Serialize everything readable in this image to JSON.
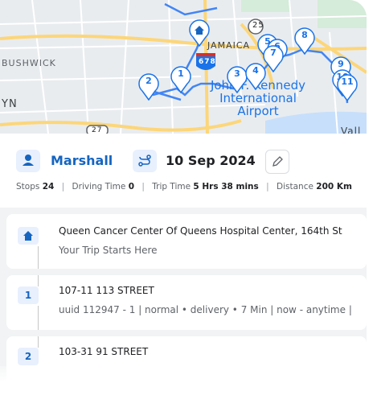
{
  "map": {
    "labels": {
      "bushwick": "BUSHWICK",
      "yn": "YN",
      "jamaica": "JAMAICA",
      "kennedy": "John F. Kennedy International Airport",
      "route_shield": "678",
      "highway_25": "25",
      "highway_27": "27",
      "vall": "Vall"
    },
    "markers": [
      "1",
      "2",
      "3",
      "4",
      "5",
      "6",
      "7",
      "8",
      "9",
      "10",
      "11"
    ]
  },
  "driver": {
    "name": "Marshall"
  },
  "trip": {
    "date": "10 Sep 2024"
  },
  "stats": {
    "stops_label": "Stops",
    "stops_value": "24",
    "driving_label": "Driving Time",
    "driving_value": "0",
    "trip_label": "Trip Time",
    "trip_value": "5 Hrs 38 mins",
    "distance_label": "Distance",
    "distance_value": "200 Km"
  },
  "stops": [
    {
      "badge": "home",
      "title": "Queen Cancer Center Of Queens Hospital Center, 164th St",
      "subtitle": "Your Trip Starts Here"
    },
    {
      "badge": "1",
      "title": "107-11 113 STREET",
      "subtitle": "uuid 112947 - 1 | normal • delivery • 7 Min | now - anytime |"
    },
    {
      "badge": "2",
      "title": "103-31 91 STREET",
      "subtitle": ""
    }
  ],
  "colors": {
    "accent": "#1565c0",
    "route": "#4285f4",
    "marker_border": "#1a73e8",
    "highway": "#fbc02d"
  }
}
